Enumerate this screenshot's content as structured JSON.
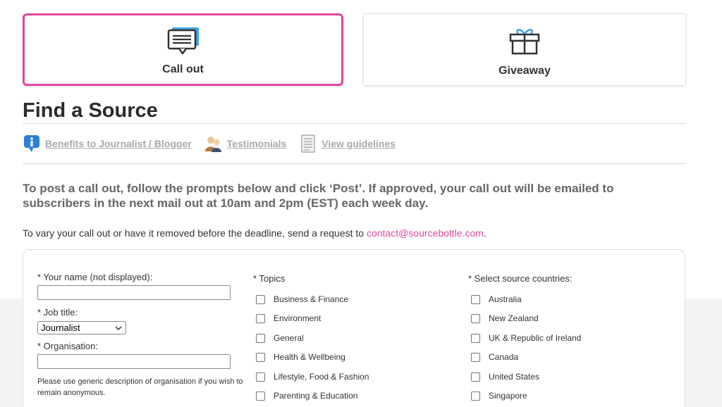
{
  "cards": {
    "callout_label": "Call out",
    "giveaway_label": "Giveaway"
  },
  "title": "Find a Source",
  "links": {
    "benefits": "Benefits to Journalist / Blogger",
    "testimonials": "Testimonials",
    "guidelines": "View guidelines"
  },
  "intro": "To post a call out, follow the prompts below and click ‘Post’. If approved, your call out will be emailed to subscribers in the next mail out at 10am and 2pm (EST) each week day.",
  "vary": {
    "text": "To vary your call out or have it removed before the deadline, send a request to ",
    "email": "contact@sourcebottle.com",
    "end": "."
  },
  "form": {
    "name_label": "* Your name (not displayed):",
    "name_value": "",
    "job_label": "* Job title:",
    "job_selected": "Journalist",
    "org_label": "* Organisation:",
    "org_value": "",
    "org_note": "Please use generic description of organisation if you wish to remain anonymous."
  },
  "topics": {
    "label": "* Topics",
    "items": [
      "Business & Finance",
      "Environment",
      "General",
      "Health & Wellbeing",
      "Lifestyle, Food & Fashion",
      "Parenting & Education"
    ]
  },
  "countries": {
    "label": "* Select source countries:",
    "items": [
      "Australia",
      "New Zealand",
      "UK & Republic of Ireland",
      "Canada",
      "United States",
      "Singapore"
    ]
  },
  "colors": {
    "accent": "#e0479d",
    "link_gray": "#a9a9a9",
    "intro_gray": "#666666"
  },
  "icons": {
    "callout": "speech-bubble-icon",
    "giveaway": "gift-icon",
    "benefits": "info-bubble-icon",
    "testimonials": "people-icon",
    "guidelines": "document-icon",
    "select": "chevron-down-icon"
  }
}
